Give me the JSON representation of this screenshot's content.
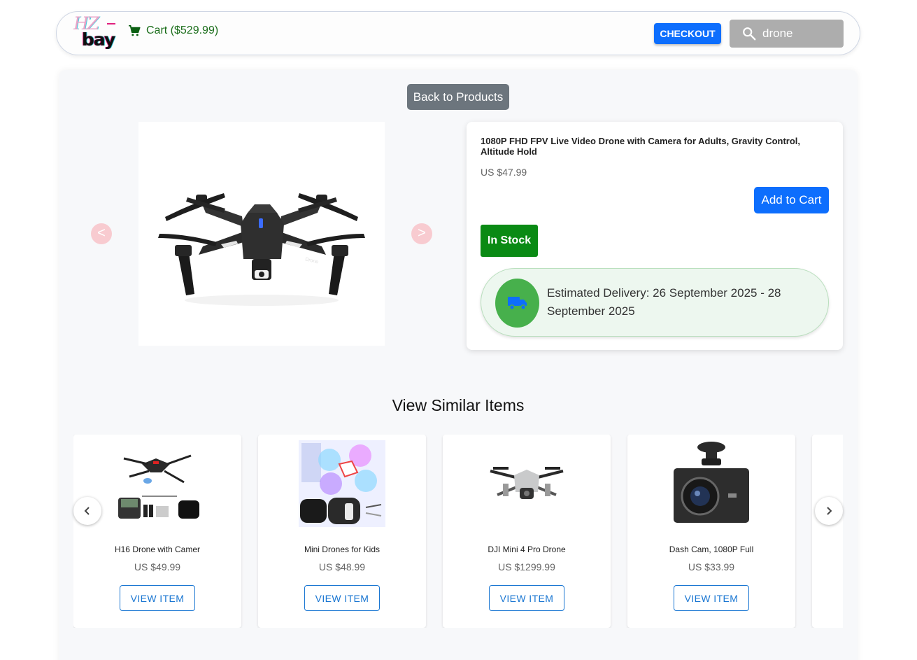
{
  "header": {
    "logo_text": "HZ bay",
    "cart_label": "Cart ($529.99)",
    "checkout_label": "CHECKOUT",
    "search_value": "drone"
  },
  "product": {
    "back_label": "Back to Products",
    "prev_arrow": "<",
    "next_arrow": ">",
    "title": "1080P FHD FPV Live Video Drone with Camera for Adults, Gravity Control, Altitude Hold",
    "price": "US $47.99",
    "add_to_cart_label": "Add to Cart",
    "stock_status": "In Stock",
    "delivery_text": "Estimated Delivery: 26 September 2025 - 28 September 2025",
    "image_badge": "Drone"
  },
  "similar": {
    "heading": "View Similar Items",
    "items": [
      {
        "name": "H16 Drone with Camer",
        "price": "US $49.99",
        "button": "VIEW ITEM"
      },
      {
        "name": "Mini Drones for Kids",
        "price": "US $48.99",
        "button": "VIEW ITEM"
      },
      {
        "name": "DJI Mini 4 Pro Drone",
        "price": "US $1299.99",
        "button": "VIEW ITEM"
      },
      {
        "name": "Dash Cam, 1080P Full",
        "price": "US $33.99",
        "button": "VIEW ITEM"
      }
    ]
  },
  "colors": {
    "primary": "#0d6efd",
    "secondary": "#6c757d",
    "in_stock": "#0a8a14",
    "delivery_icon_bg": "#47b04c",
    "outline_button": "#1976d2"
  }
}
